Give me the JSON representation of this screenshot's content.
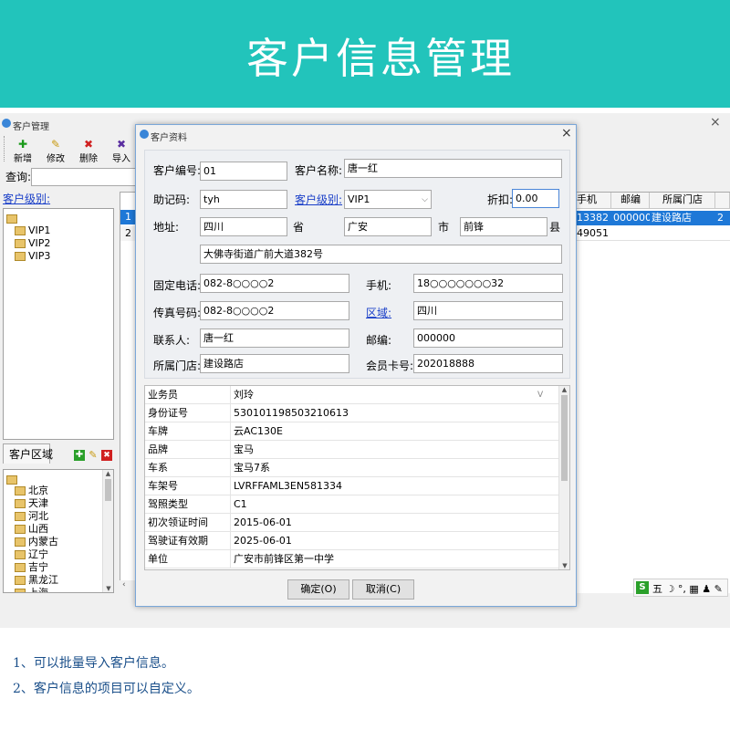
{
  "banner": {
    "title": "客户信息管理"
  },
  "main_window": {
    "title": "客户管理",
    "close_glyph": "×",
    "toolbar": [
      {
        "label": "新增",
        "icon": "add-icon"
      },
      {
        "label": "修改",
        "icon": "edit-icon"
      },
      {
        "label": "删除",
        "icon": "delete-icon"
      },
      {
        "label": "导入",
        "icon": "import-icon"
      }
    ],
    "search_label": "查询:",
    "level_link": "客户级别:",
    "level_tree": [
      "VIP1",
      "VIP2",
      "VIP3"
    ],
    "region_tab": "客户区域",
    "region_tree": [
      "北京",
      "天津",
      "河北",
      "山西",
      "内蒙古",
      "辽宁",
      "吉宁",
      "黑龙江",
      "上海"
    ],
    "grid": {
      "headers": [
        "手机",
        "邮编",
        "所属门店"
      ],
      "rows": [
        {
          "no": "1",
          "phone": "13382",
          "zip": "000000",
          "store": "建设路店",
          "extra": "2"
        },
        {
          "no": "2",
          "phone": "49051",
          "zip": "",
          "store": "",
          "extra": ""
        }
      ]
    },
    "ime_bar": "五 ☽ °, ▦ ♟ ✎"
  },
  "dialog": {
    "title": "客户资料",
    "close_glyph": "×",
    "labels": {
      "code": "客户编号:",
      "name": "客户名称:",
      "mnemonic": "助记码:",
      "level": "客户级别:",
      "discount": "折扣:",
      "address": "地址:",
      "province": "省",
      "city": "市",
      "county": "县",
      "phone": "固定电话:",
      "mobile": "手机:",
      "fax": "传真号码:",
      "region": "区域:",
      "contact": "联系人:",
      "zip": "邮编:",
      "store": "所属门店:",
      "card": "会员卡号:"
    },
    "values": {
      "code": "01",
      "name": "唐一红",
      "mnemonic": "tyh",
      "level": "VIP1",
      "discount": "0.00",
      "province": "四川",
      "city": "广安",
      "county": "前锋",
      "street": "大佛寺街道广前大道382号",
      "phone": "082-8○○○○2",
      "mobile": "18○○○○○○○32",
      "fax": "082-8○○○○2",
      "region": "四川",
      "contact": "唐一红",
      "zip": "000000",
      "store": "建设路店",
      "card": "202018888"
    },
    "props": [
      {
        "key": "业务员",
        "value": "刘玲"
      },
      {
        "key": "身份证号",
        "value": "530101198503210613"
      },
      {
        "key": "车牌",
        "value": "云AC130E"
      },
      {
        "key": "品牌",
        "value": "宝马"
      },
      {
        "key": "车系",
        "value": "宝马7系"
      },
      {
        "key": "车架号",
        "value": "LVRFFAML3EN581334"
      },
      {
        "key": "驾照类型",
        "value": "C1"
      },
      {
        "key": "初次领证时间",
        "value": "2015-06-01"
      },
      {
        "key": "驾驶证有效期",
        "value": "2025-06-01"
      },
      {
        "key": "单位",
        "value": "广安市前锋区第一中学"
      }
    ],
    "ok_label": "确定(O)",
    "cancel_label": "取消(C)"
  },
  "notes": [
    "1、可以批量导入客户信息。",
    "2、客户信息的项目可以自定义。"
  ]
}
